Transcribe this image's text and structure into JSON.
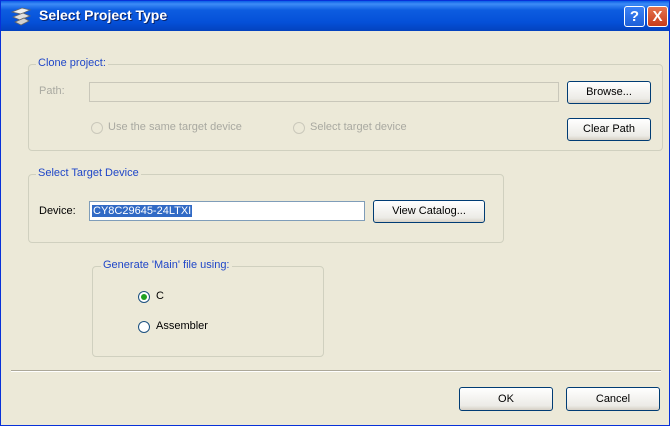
{
  "window": {
    "title": "Select Project Type",
    "help_glyph": "?",
    "close_glyph": "X"
  },
  "clone": {
    "legend": "Clone project:",
    "path_label": "Path:",
    "path_value": "",
    "browse_label": "Browse...",
    "clear_label": "Clear Path",
    "radio_same": "Use the same target device",
    "radio_select": "Select target device"
  },
  "target": {
    "legend": "Select Target Device",
    "device_label": "Device:",
    "device_value": "CY8C29645-24LTXI",
    "catalog_label": "View Catalog..."
  },
  "main_file": {
    "legend": "Generate 'Main' file using:",
    "options": [
      {
        "label": "C",
        "checked": true
      },
      {
        "label": "Assembler",
        "checked": false
      }
    ]
  },
  "footer": {
    "ok_label": "OK",
    "cancel_label": "Cancel"
  },
  "colors": {
    "title_bar": "#0550d8",
    "legend_text": "#1f46c8",
    "radio_dot": "#21a121",
    "selection": "#316ac5"
  }
}
